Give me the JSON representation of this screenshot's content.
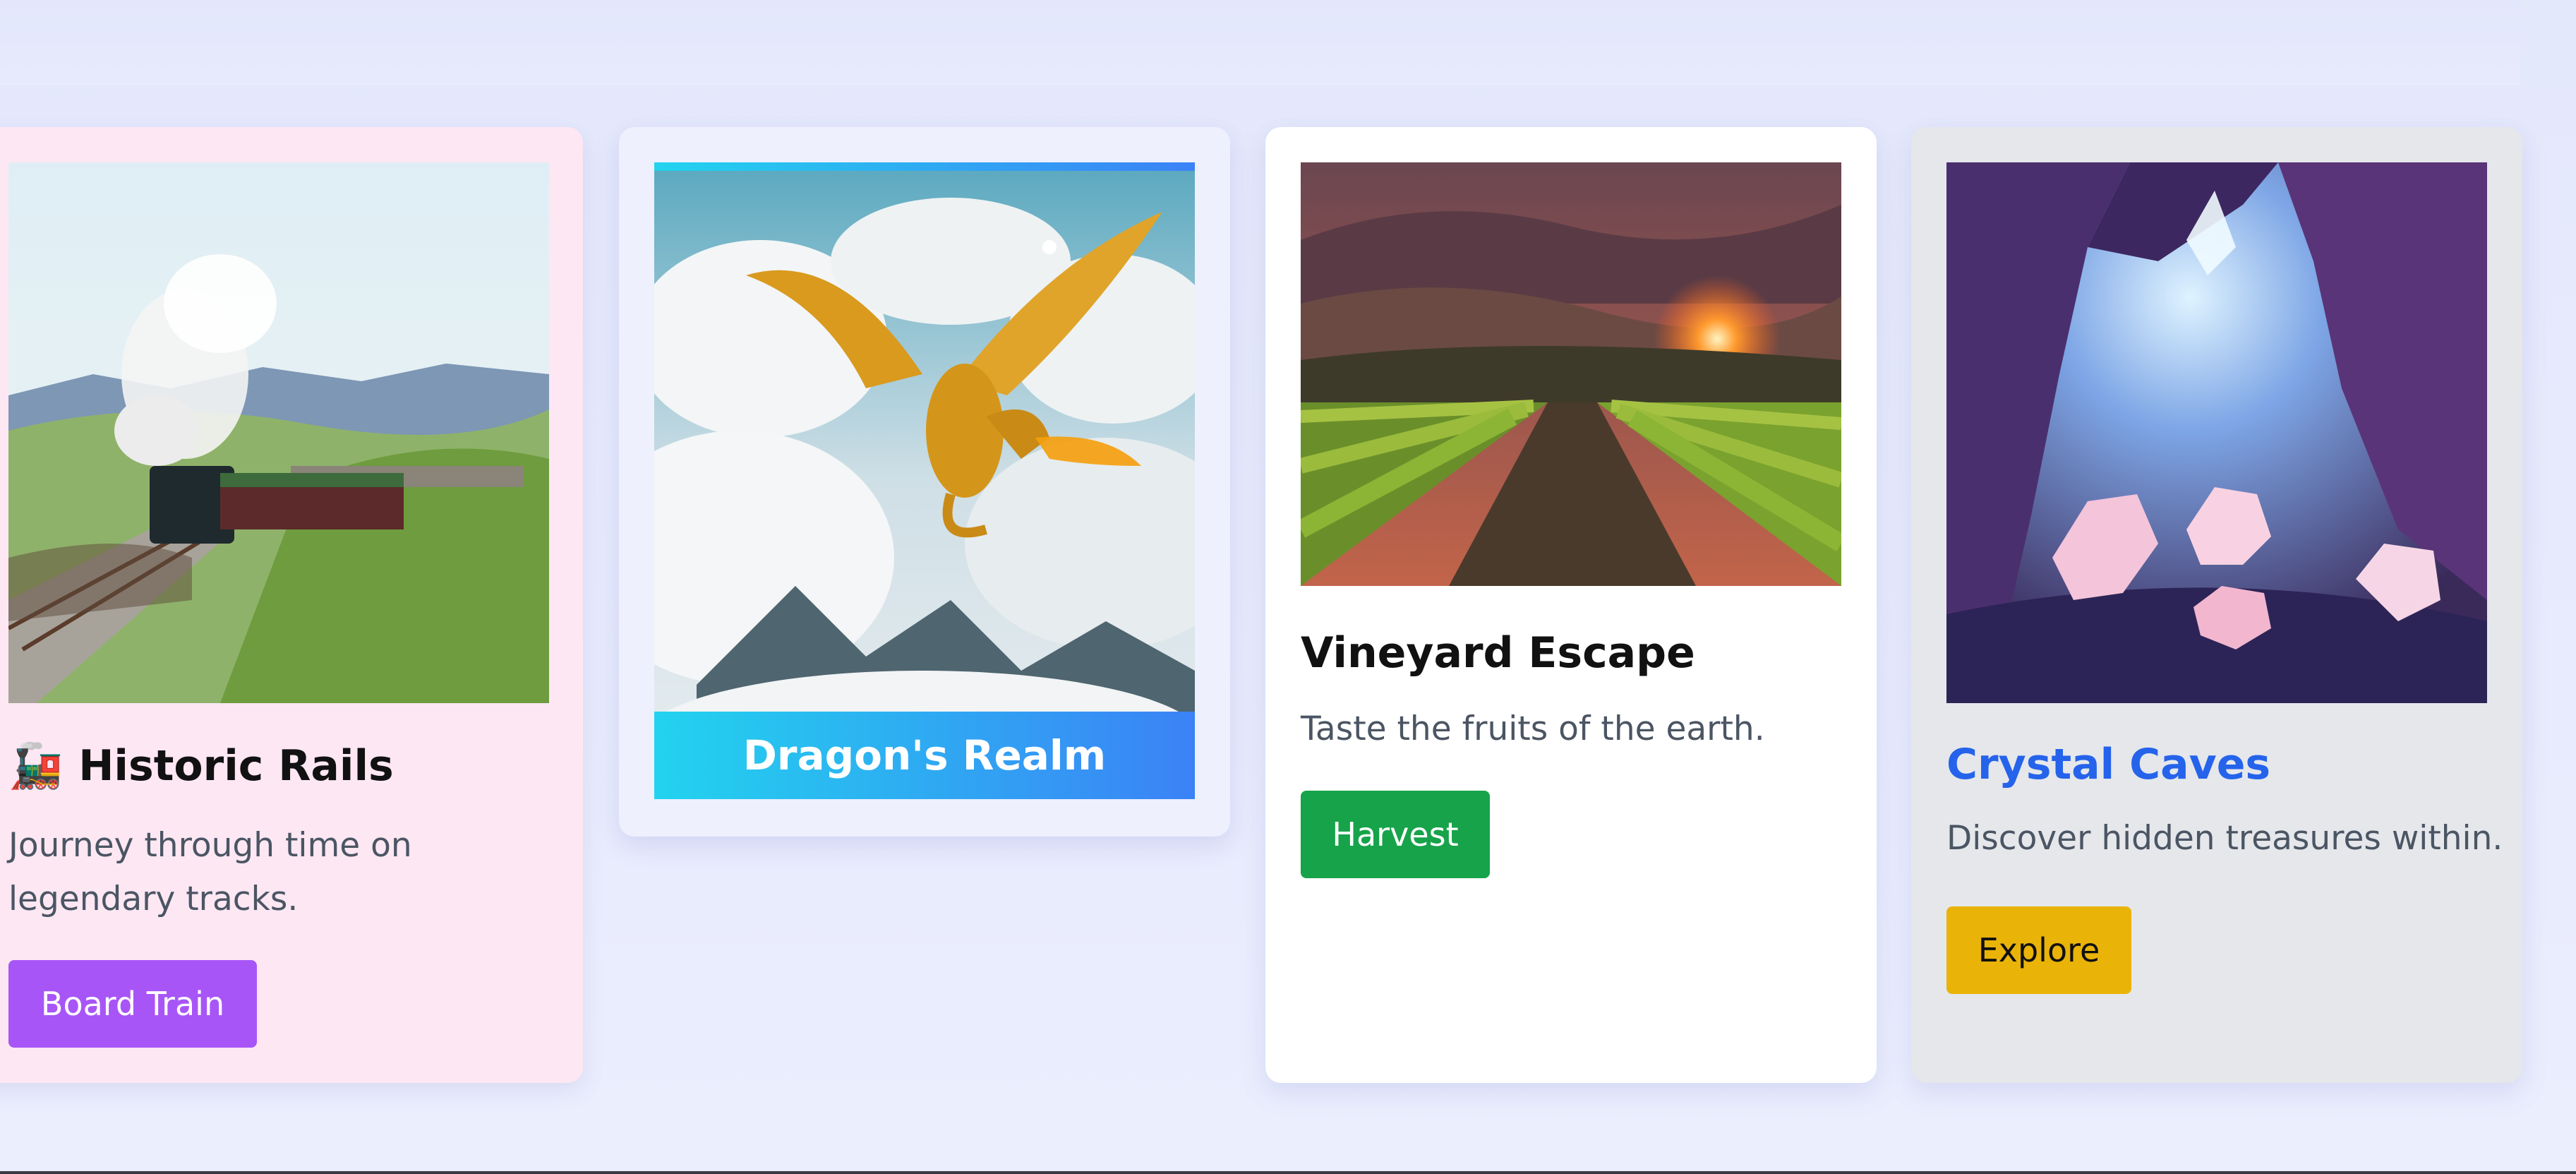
{
  "cards": [
    {
      "id": "historic-rails",
      "icon": "🚂",
      "title": "Historic Rails",
      "description": "Journey through time on legendary tracks.",
      "button_label": "Board Train",
      "background": "#fce7f3",
      "button_color": "#a855f7"
    },
    {
      "id": "dragons-realm",
      "title": "Dragon's Realm",
      "accent_gradient": [
        "#22d3ee",
        "#3b82f6"
      ]
    },
    {
      "id": "vineyard-escape",
      "title": "Vineyard Escape",
      "description": "Taste the fruits of the earth.",
      "button_label": "Harvest",
      "background": "#ffffff",
      "button_color": "#16a34a"
    },
    {
      "id": "crystal-caves",
      "title": "Crystal Caves",
      "description": "Discover hidden treasures within.",
      "button_label": "Explore",
      "background": "#e5e7eb",
      "button_color": "#eab308",
      "title_color": "#2563eb"
    }
  ]
}
